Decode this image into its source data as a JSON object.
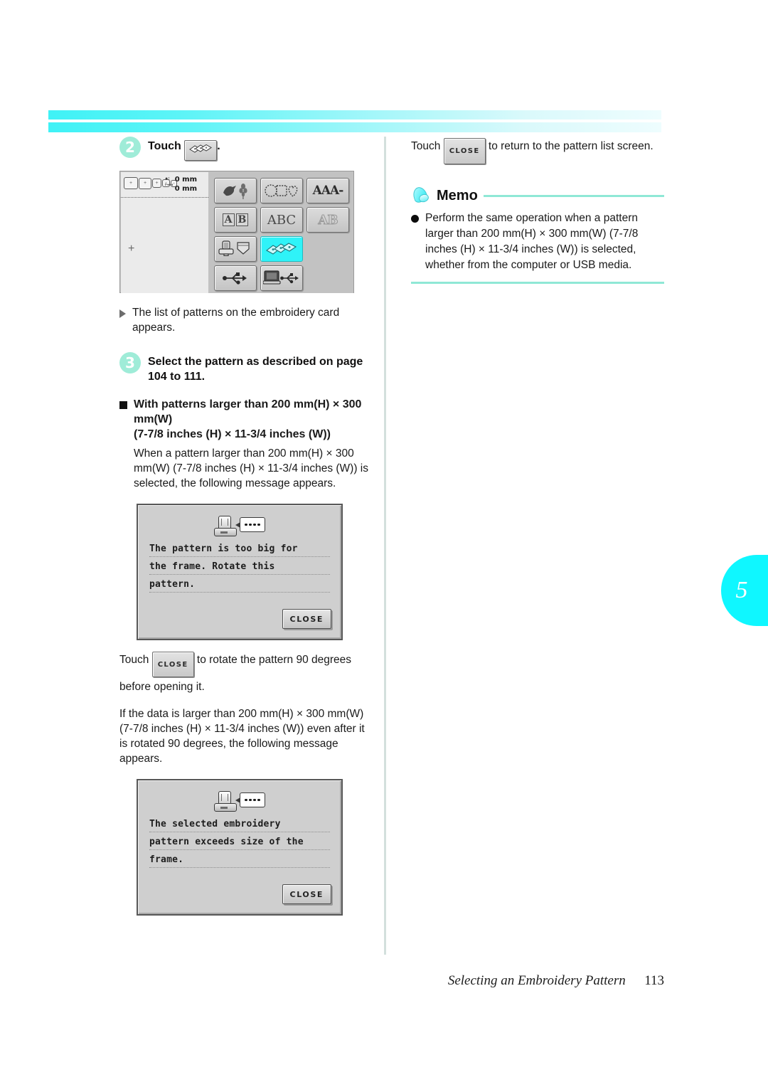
{
  "chapter_tab": {
    "number": "5"
  },
  "left_column": {
    "step2": {
      "number": "2",
      "text_before": "Touch",
      "icon": "embroidery-cards-icon",
      "text_after": "."
    },
    "lcd": {
      "status": {
        "hoop_icons": [
          "hoop-large",
          "hoop-medium",
          "hoop-small",
          "hoop-xsmall",
          "hoop-tiny"
        ],
        "vertical_icon": "vertical-size-icon",
        "horizontal_icon": "horizontal-size-icon",
        "value_vertical": "0 mm",
        "value_horizontal": "0 mm"
      },
      "center_mark": "+",
      "keys": [
        {
          "name": "key-animal-floral-patterns",
          "glyph": "bird-floral-icon",
          "selected": false
        },
        {
          "name": "key-geometric-shapes",
          "glyph": "circle-square-heart-icon",
          "selected": false
        },
        {
          "name": "key-alphabet-fonts",
          "label": "AAA-",
          "selected": false
        },
        {
          "name": "key-framed-alphabet",
          "label": "AB",
          "selected": false
        },
        {
          "name": "key-abc-font",
          "label": "ABC",
          "selected": false
        },
        {
          "name": "key-outline-alphabet",
          "label": "AB",
          "selected": false
        },
        {
          "name": "key-machine-utility-patterns",
          "glyph": "machine-pocket-icon",
          "selected": false
        },
        {
          "name": "key-embroidery-cards",
          "glyph": "embroidery-cards-icon",
          "selected": true
        },
        {
          "name": "key-usb-media",
          "glyph": "usb-icon",
          "selected": false
        },
        {
          "name": "key-computer",
          "glyph": "computer-usb-icon",
          "selected": false
        }
      ]
    },
    "result_note": "The list of patterns on the embroidery card appears.",
    "step3": {
      "number": "3",
      "text": "Select the pattern as described on page 104 to 111."
    },
    "section_heading_line1": "With patterns larger than 200 mm(H) × 300 mm(W)",
    "section_heading_line2": "(7-7/8 inches (H) × 11-3/4 inches (W))",
    "section_body": "When a pattern larger than 200 mm(H) × 300 mm(W) (7-7/8 inches (H) × 11-3/4 inches (W)) is selected, the following message appears.",
    "dialog1": {
      "icon": "sewing-machine-message-icon",
      "lines": [
        "The pattern is too big for",
        "the frame. Rotate this",
        "pattern."
      ],
      "close_label": "CLOSE"
    },
    "rotate_note_before": "Touch",
    "rotate_note_chip": "CLOSE",
    "rotate_note_after": "to rotate the pattern 90 degrees before opening it.",
    "oversize_note": "If the data is larger than 200 mm(H) × 300 mm(W) (7-7/8 inches (H) × 11-3/4 inches (W)) even after it is rotated 90 degrees, the following message appears.",
    "dialog2": {
      "icon": "sewing-machine-message-icon",
      "lines": [
        "The selected embroidery",
        "pattern exceeds size of the",
        "frame."
      ],
      "close_label": "CLOSE"
    }
  },
  "right_column": {
    "return_note_before": "Touch",
    "return_note_chip": "CLOSE",
    "return_note_after": "to return to the pattern list screen.",
    "memo": {
      "icon": "bell-icon",
      "title": "Memo",
      "items": [
        "Perform the same operation when a pattern larger than 200 mm(H) × 300 mm(W) (7-7/8 inches (H) × 11-3/4 inches (W)) is selected, whether from the computer or USB media."
      ]
    }
  },
  "footer": {
    "section_title": "Selecting an Embroidery Pattern",
    "page_number": "113"
  },
  "colors": {
    "accent_cyan": "#0ff7ff",
    "step_circle": "#9fecd8",
    "memo_rule": "#8fe8d6",
    "lcd_selected": "#2ff3f8"
  }
}
